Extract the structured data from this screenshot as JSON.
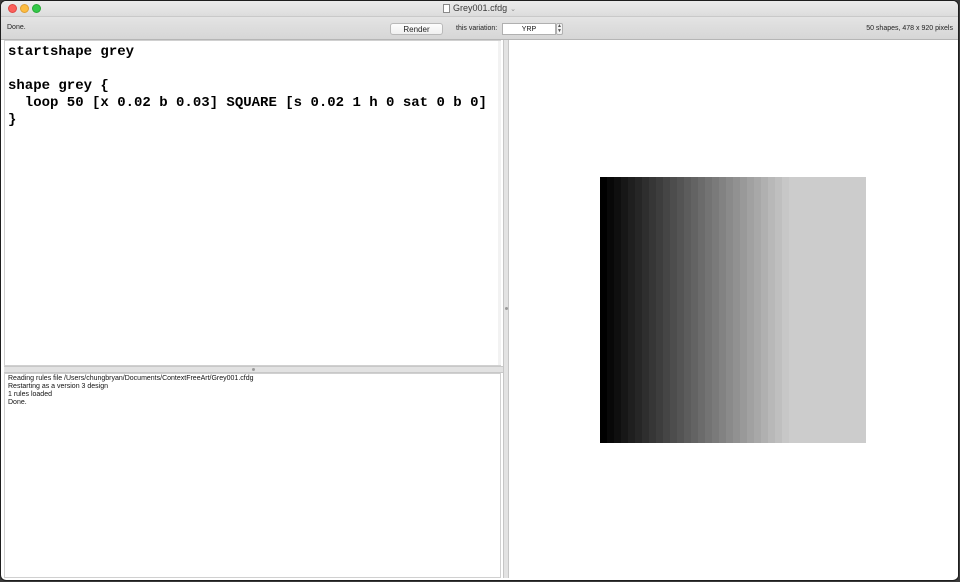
{
  "window": {
    "title": "Grey001.cfdg",
    "title_chevron": "⌄",
    "stepper_up": "▲",
    "stepper_down": "▼"
  },
  "toolbar": {
    "status_left": "Done.",
    "render_label": "Render",
    "variation_label": "this variation:",
    "variation_value": "YRP",
    "status_right": "50 shapes, 478 x 920 pixels"
  },
  "editor": {
    "code": "startshape grey\n\nshape grey {\n  loop 50 [x 0.02 b 0.03] SQUARE [s 0.02 1 h 0 sat 0 b 0]\n}"
  },
  "log": {
    "lines": [
      "Reading rules file /Users/chungbryan/Documents/ContextFreeArt/Grey001.cfdg",
      "Restarting as a version 3 design",
      "1 rules loaded",
      "Done."
    ]
  },
  "output": {
    "shape_count": 50,
    "brightness_step": 0.03
  }
}
